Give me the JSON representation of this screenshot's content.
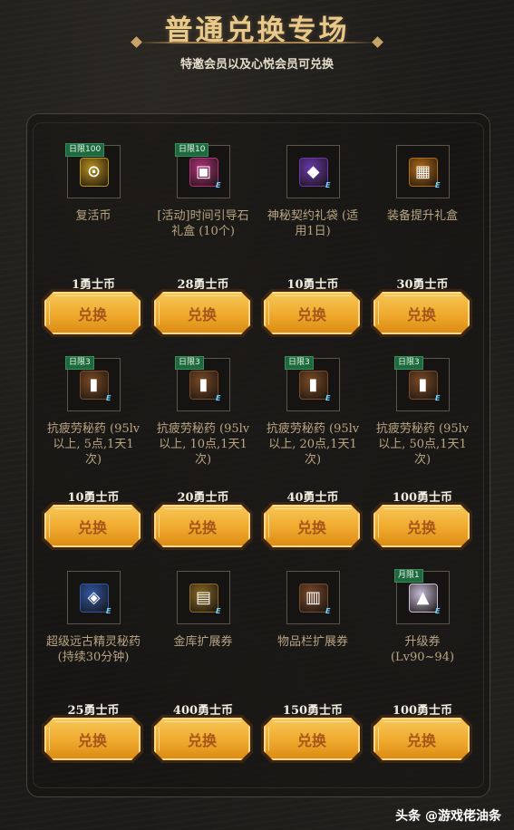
{
  "header": {
    "title": "普通兑换专场",
    "subtitle": "特邀会员以及心悦会员可兑换"
  },
  "items": [
    {
      "limit": "日限100",
      "name": "复活币",
      "price": "1勇士币",
      "button": "兑换",
      "icon": "revive-coin-icon",
      "color": "#b8911e"
    },
    {
      "limit": "日限10",
      "name": "[活动]时间引导石礼盒 (10个)",
      "price": "28勇士币",
      "button": "兑换",
      "icon": "gift-box-icon",
      "color": "#b0327c"
    },
    {
      "limit": "",
      "name": "神秘契约礼袋 (适用1日)",
      "price": "10勇士币",
      "button": "兑换",
      "icon": "mystery-bag-icon",
      "color": "#6a3ab0"
    },
    {
      "limit": "",
      "name": "装备提升礼盒",
      "price": "30勇士币",
      "button": "兑换",
      "icon": "equipment-box-icon",
      "color": "#b26a16"
    },
    {
      "limit": "日限3",
      "name": "抗疲劳秘药 (95lv以上, 5点,1天1次)",
      "price": "10勇士币",
      "button": "兑换",
      "icon": "potion-icon",
      "color": "#7a4a25"
    },
    {
      "limit": "日限3",
      "name": "抗疲劳秘药 (95lv以上, 10点,1天1次)",
      "price": "20勇士币",
      "button": "兑换",
      "icon": "potion-icon",
      "color": "#7a4a25"
    },
    {
      "limit": "日限3",
      "name": "抗疲劳秘药 (95lv以上, 20点,1天1次)",
      "price": "40勇士币",
      "button": "兑换",
      "icon": "potion-icon",
      "color": "#7a4a25"
    },
    {
      "limit": "日限3",
      "name": "抗疲劳秘药 (95lv以上, 50点,1天1次)",
      "price": "100勇士币",
      "button": "兑换",
      "icon": "potion-icon",
      "color": "#7a4a25"
    },
    {
      "limit": "",
      "name": "超级远古精灵秘药 (持续30分钟)",
      "price": "25勇士币",
      "button": "兑换",
      "icon": "elixir-icon",
      "color": "#2f58a8"
    },
    {
      "limit": "",
      "name": "金库扩展券",
      "price": "400勇士币",
      "button": "兑换",
      "icon": "vault-ticket-icon",
      "color": "#8a6a24"
    },
    {
      "limit": "",
      "name": "物品栏扩展券",
      "price": "150勇士币",
      "button": "兑换",
      "icon": "inventory-ticket-icon",
      "color": "#7a4a2c"
    },
    {
      "limit": "月限1",
      "name": "升级券 (Lv90~94)",
      "price": "100勇士币",
      "button": "兑换",
      "icon": "level-ticket-icon",
      "color": "#c7bcd8"
    }
  ],
  "watermark": "头条 @游戏佬油条"
}
